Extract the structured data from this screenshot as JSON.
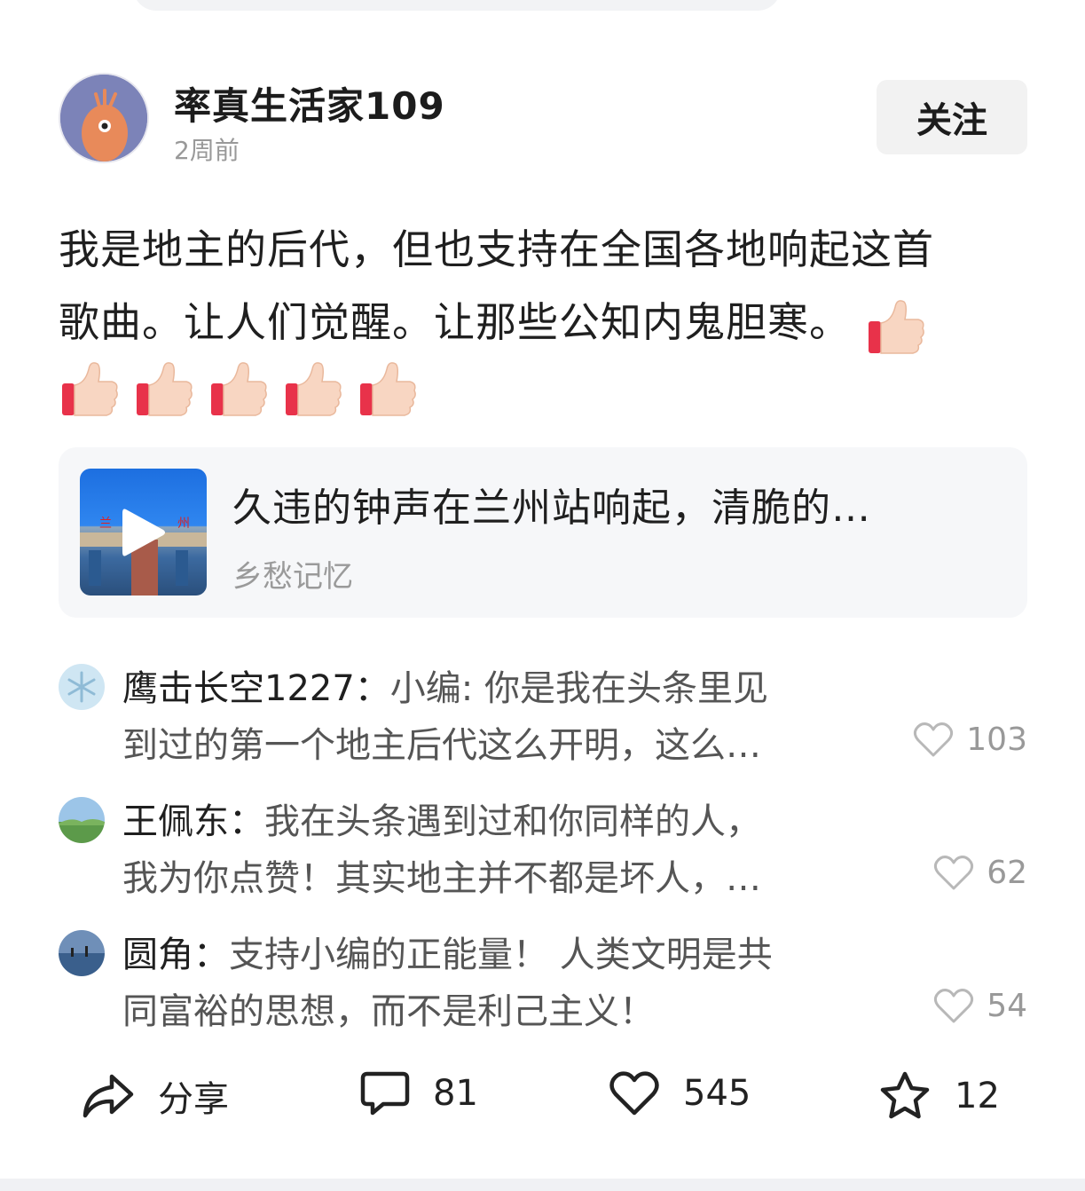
{
  "author": {
    "name": "率真生活家109",
    "time": "2周前",
    "follow_label": "关注"
  },
  "post": {
    "line1": "我是地主的后代，但也支持在全国各地响起这首",
    "line2": "歌曲。让人们觉醒。让那些公知内鬼胆寒。",
    "emoji": "thumbs-up-icon",
    "emoji_count": 6
  },
  "link_card": {
    "title": "久违的钟声在兰州站响起，清脆的…",
    "source": "乡愁记忆",
    "thumb_sign_left": "兰",
    "thumb_sign_right": "州"
  },
  "comments": [
    {
      "name": "鹰击长空1227",
      "sep": "：",
      "line1": "小编: 你是我在头条里见",
      "line2": "到过的第一个地主后代这么开明，这么…",
      "likes": "103"
    },
    {
      "name": "王佩东",
      "sep": "：",
      "line1": "我在头条遇到过和你同样的人，",
      "line2": "我为你点赞！其实地主并不都是坏人，…",
      "likes": "62"
    },
    {
      "name": "圆角",
      "sep": "：",
      "line1": "支持小编的正能量！ 人类文明是共",
      "line2": "同富裕的思想，而不是利己主义！",
      "likes": "54"
    }
  ],
  "actions": {
    "share_label": "分享",
    "comments": "81",
    "likes": "545",
    "favorites": "12"
  },
  "colors": {
    "accent_thumb": "#e8324a",
    "text_primary": "#1f1f1f",
    "text_muted": "#999999"
  }
}
